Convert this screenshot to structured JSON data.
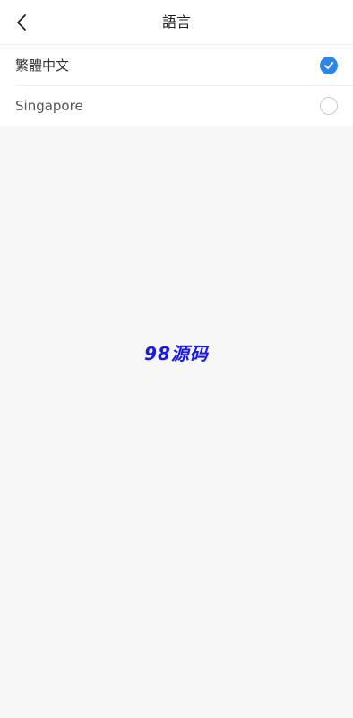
{
  "header": {
    "title": "語言",
    "back_icon": "chevron-left-icon"
  },
  "languages": [
    {
      "label": "繁體中文",
      "selected": true
    },
    {
      "label": "Singapore",
      "selected": false
    }
  ],
  "watermark": "98源码",
  "colors": {
    "accent": "#2b86e8",
    "background": "#f7f7f7",
    "watermark": "#1a1ae6"
  }
}
